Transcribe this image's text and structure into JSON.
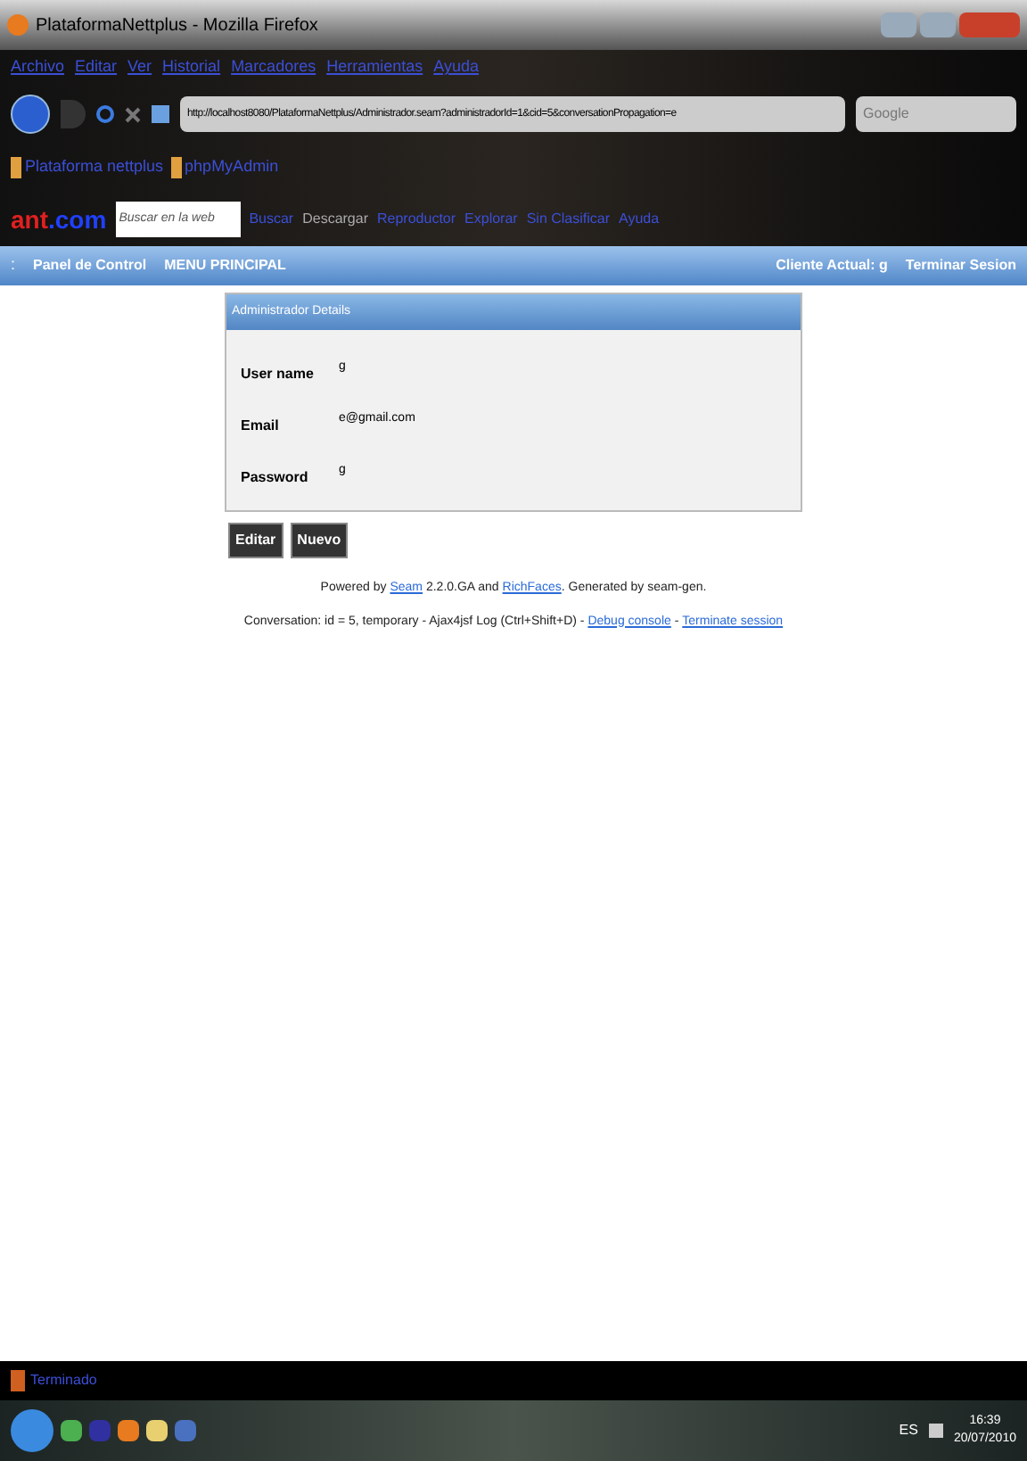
{
  "window": {
    "title": "PlataformaNettplus - Mozilla Firefox"
  },
  "menu": [
    "Archivo",
    "Editar",
    "Ver",
    "Historial",
    "Marcadores",
    "Herramientas",
    "Ayuda"
  ],
  "address": {
    "value": "http://localhost8080/PlataformaNettplus/Administrador.seam?administradorId=1&cid=5&conversationPropagation=e"
  },
  "search": {
    "placeholder": "Google"
  },
  "bookmarks": [
    "Plataforma nettplus",
    "phpMyAdmin"
  ],
  "toolbar": {
    "logo": [
      "ant",
      ".com"
    ],
    "search_placeholder": "Buscar en la web",
    "items": [
      "Buscar",
      "Descargar",
      "Reproductor",
      "Explorar",
      "Sin Clasificar",
      "Ayuda"
    ]
  },
  "app_nav": {
    "handle": ":",
    "left": [
      "Panel de Control",
      "MENU PRINCIPAL"
    ],
    "right": [
      "Cliente Actual: g",
      "Terminar Sesion"
    ]
  },
  "panel": {
    "title": "Administrador Details",
    "fields": [
      {
        "label": "User name",
        "value": "g"
      },
      {
        "label": "Email",
        "value": "e@gmail.com"
      },
      {
        "label": "Password",
        "value": "g"
      }
    ]
  },
  "buttons": [
    "Editar",
    "Nuevo"
  ],
  "footer": [
    {
      "parts": [
        {
          "text": "Powered by ",
          "link": false
        },
        {
          "text": "Seam",
          "link": true
        },
        {
          "text": " 2.2.0.GA and ",
          "link": false
        },
        {
          "text": "RichFaces",
          "link": true
        },
        {
          "text": ". Generated by seam-gen.",
          "link": false
        }
      ]
    },
    {
      "parts": [
        {
          "text": "Conversation: id = 5, temporary - Ajax4jsf Log (Ctrl+Shift+D) - ",
          "link": false
        },
        {
          "text": "Debug console",
          "link": true
        },
        {
          "text": " - ",
          "link": false
        },
        {
          "text": "Terminate session",
          "link": true
        }
      ]
    }
  ],
  "status_bar": {
    "text": "Terminado"
  },
  "taskbar": {
    "language": "ES",
    "time": "16:39",
    "date": "20/07/2010"
  }
}
